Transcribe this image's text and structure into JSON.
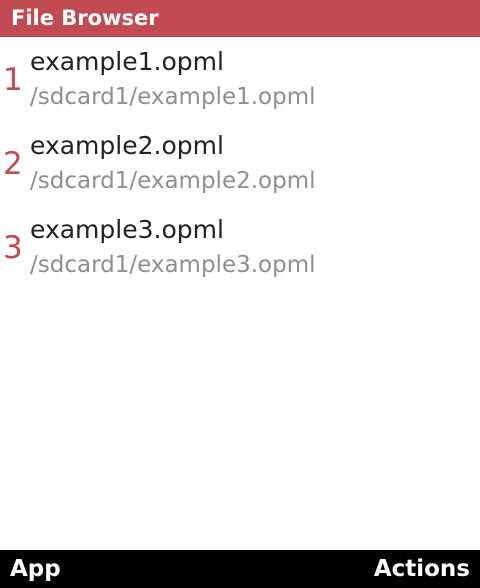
{
  "titlebar": {
    "title": "File Browser",
    "color": "#c24a52"
  },
  "files": [
    {
      "index": "1",
      "name": "example1.opml",
      "path": "/sdcard1/example1.opml"
    },
    {
      "index": "2",
      "name": "example2.opml",
      "path": "/sdcard1/example2.opml"
    },
    {
      "index": "3",
      "name": "example3.opml",
      "path": "/sdcard1/example3.opml"
    }
  ],
  "softkeys": {
    "left": "App",
    "right": "Actions"
  }
}
